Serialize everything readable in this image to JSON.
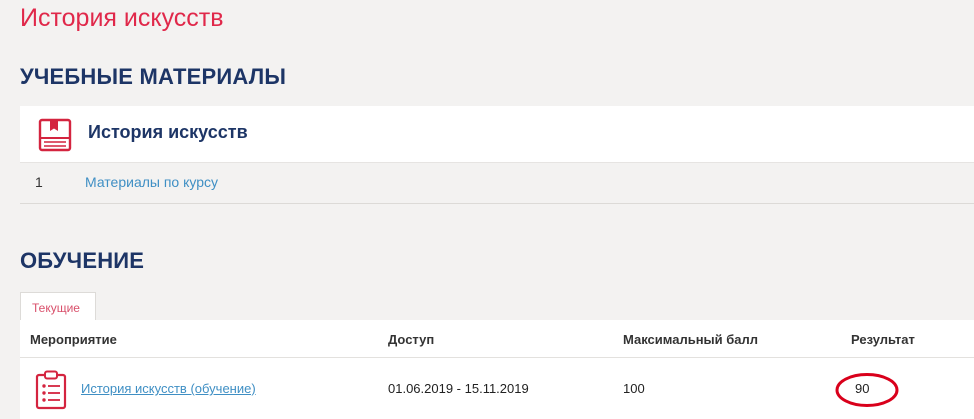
{
  "page": {
    "title": "История искусств"
  },
  "materials": {
    "heading": "УЧЕБНЫЕ МАТЕРИАЛЫ",
    "card_title": "История искусств",
    "card_icon": "book-icon",
    "items": [
      {
        "number": "1",
        "label": "Материалы по курсу"
      }
    ]
  },
  "learning": {
    "heading": "ОБУЧЕНИЕ",
    "tabs": [
      {
        "label": "Текущие",
        "active": true
      }
    ],
    "columns": [
      "Мероприятие",
      "Доступ",
      "Максимальный балл",
      "Результат"
    ],
    "rows": [
      {
        "icon": "clipboard-checklist-icon",
        "event": "История искусств (обучение)",
        "access": "01.06.2019 - 15.11.2019",
        "max_score": "100",
        "result": "90"
      }
    ]
  },
  "colors": {
    "accent": "#e0284a",
    "heading": "#1d3566",
    "link": "#3f8fc4",
    "annotation": "#d9001b"
  }
}
